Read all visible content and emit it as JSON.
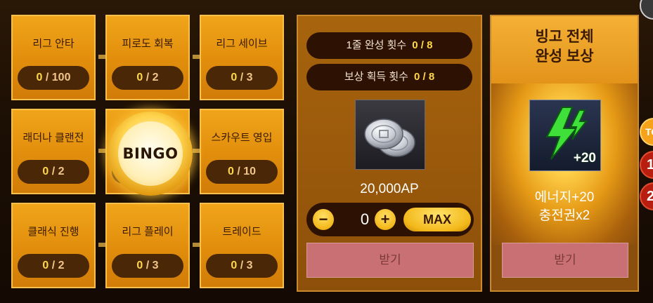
{
  "bingo": {
    "center_label": "BINGO",
    "cells": [
      {
        "label": "리그 안타",
        "current": "0",
        "max": "100"
      },
      {
        "label": "피로도 회복",
        "current": "0",
        "max": "2"
      },
      {
        "label": "리그 세이브",
        "current": "0",
        "max": "3"
      },
      {
        "label": "래더나 클랜전",
        "current": "0",
        "max": "2"
      },
      {
        "label": "",
        "current": "",
        "max": ""
      },
      {
        "label": "스카우트 영입",
        "current": "0",
        "max": "10"
      },
      {
        "label": "클래식 진행",
        "current": "0",
        "max": "2"
      },
      {
        "label": "리그 플레이",
        "current": "0",
        "max": "3"
      },
      {
        "label": "트레이드",
        "current": "0",
        "max": "3"
      }
    ],
    "separator": "/"
  },
  "reward": {
    "line_count": {
      "label": "1줄 완성 횟수",
      "current": "0",
      "max": "8"
    },
    "claim_count": {
      "label": "보상 획득 횟수",
      "current": "0",
      "max": "8"
    },
    "item_icon": "silver-coins-icon",
    "amount": "20,000AP",
    "quantity": "0",
    "minus": "−",
    "plus": "+",
    "max_label": "MAX",
    "claim_label": "받기"
  },
  "full_bingo": {
    "title_line1": "빙고 전체",
    "title_line2": "완성 보상",
    "item_icon": "green-lightning-icon",
    "badge": "+20",
    "name_line1": "에너지+20",
    "name_line2": "충전권x2",
    "claim_label": "받기"
  },
  "edge": {
    "tab1": "TO",
    "tab2": "1",
    "tab3": "2"
  },
  "colors": {
    "accent": "#ffd84a",
    "cell": "#e18d0c",
    "disabled_button": "#c97075"
  }
}
